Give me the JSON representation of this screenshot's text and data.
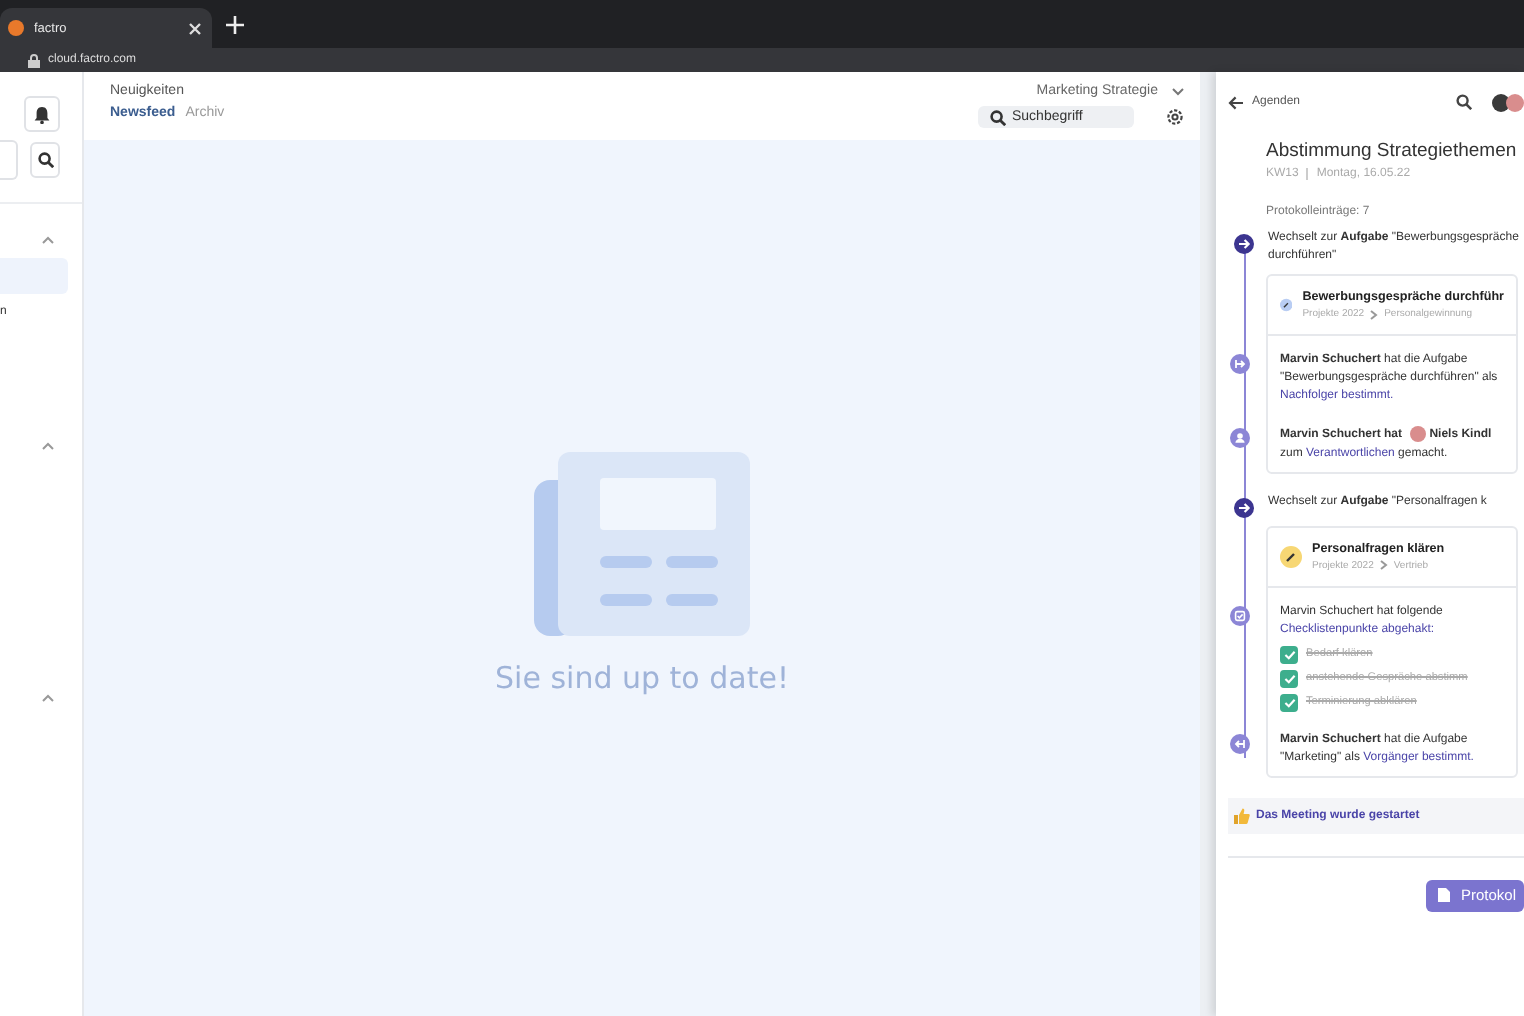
{
  "browser": {
    "tab_title": "factro",
    "url": "cloud.factro.com"
  },
  "sidebar": {
    "sections": [
      {
        "expanded": true,
        "items": [
          {
            "selected": true
          },
          {
            "label": "n",
            "selected": false
          }
        ]
      },
      {
        "expanded": true
      },
      {
        "expanded": true
      }
    ]
  },
  "main": {
    "section_title": "Neuigkeiten",
    "tabs": [
      {
        "label": "Newsfeed",
        "selected": true
      },
      {
        "label": "Archiv",
        "selected": false
      }
    ],
    "project_select": "Marketing Strategie",
    "search": {
      "placeholder": "Suchbegriff"
    },
    "empty_message": "Sie sind up to date!"
  },
  "panel": {
    "back_label": "Agenden",
    "title": "Abstimmung Strategiethemen",
    "week": "KW13",
    "date": "Montag, 16.05.22",
    "entry_count": "Protokolleinträge: 7",
    "entries": [
      {
        "parts": [
          {
            "kind": "plain",
            "text": "Wechselt zur "
          },
          {
            "kind": "bold",
            "text": "Aufgabe"
          },
          {
            "kind": "plain",
            "text": " \"Bewerbungsgespräche durchführen\""
          }
        ],
        "task": {
          "title": "Bewerbungsgespräche durchführ",
          "path": [
            "Projekte 2022",
            "Personalgewinnung"
          ],
          "color": "#b9cdf3"
        },
        "events": [
          {
            "kind": "relation",
            "parts": [
              {
                "kind": "bold",
                "text": "Marvin Schuchert"
              },
              {
                "kind": "plain",
                "text": " hat die Aufgabe \"Bewerbungsgespräche durchführen\" als "
              },
              {
                "kind": "link",
                "text": "Nachfolger bestimmt."
              }
            ]
          },
          {
            "kind": "person",
            "parts": [
              {
                "kind": "bold",
                "text": "Marvin Schuchert hat "
              },
              {
                "kind": "avatar"
              },
              {
                "kind": "bold",
                "text": "Niels Kindl"
              },
              {
                "kind": "plain",
                "text": " zum "
              },
              {
                "kind": "link",
                "text": "Verantwortlichen"
              },
              {
                "kind": "plain",
                "text": " gemacht."
              }
            ]
          }
        ]
      },
      {
        "parts": [
          {
            "kind": "plain",
            "text": "Wechselt zur "
          },
          {
            "kind": "bold",
            "text": "Aufgabe"
          },
          {
            "kind": "plain",
            "text": " \"Personalfragen k"
          }
        ],
        "task": {
          "title": "Personalfragen klären",
          "path": [
            "Projekte 2022",
            "Vertrieb"
          ],
          "color": "#f7d774"
        },
        "events": [
          {
            "kind": "checklist",
            "parts": [
              {
                "kind": "plain",
                "text": "Marvin Schuchert hat folgende "
              },
              {
                "kind": "link",
                "text": "Checklistenpunkte abgehakt:"
              }
            ],
            "checklist": [
              {
                "label": "Bedarf klären",
                "checked": true
              },
              {
                "label": "anstehende Gespräche abstimm",
                "checked": true
              },
              {
                "label": "Terminierung abklären",
                "checked": true
              }
            ]
          },
          {
            "kind": "predecessor",
            "parts": [
              {
                "kind": "bold",
                "text": "Marvin Schuchert"
              },
              {
                "kind": "plain",
                "text": " hat die Aufgabe \"Marketing\" als "
              },
              {
                "kind": "link",
                "text": "Vorgänger bestimmt."
              }
            ]
          }
        ]
      }
    ],
    "note": "Das Meeting wurde gestartet",
    "button_label": "Protokol"
  }
}
